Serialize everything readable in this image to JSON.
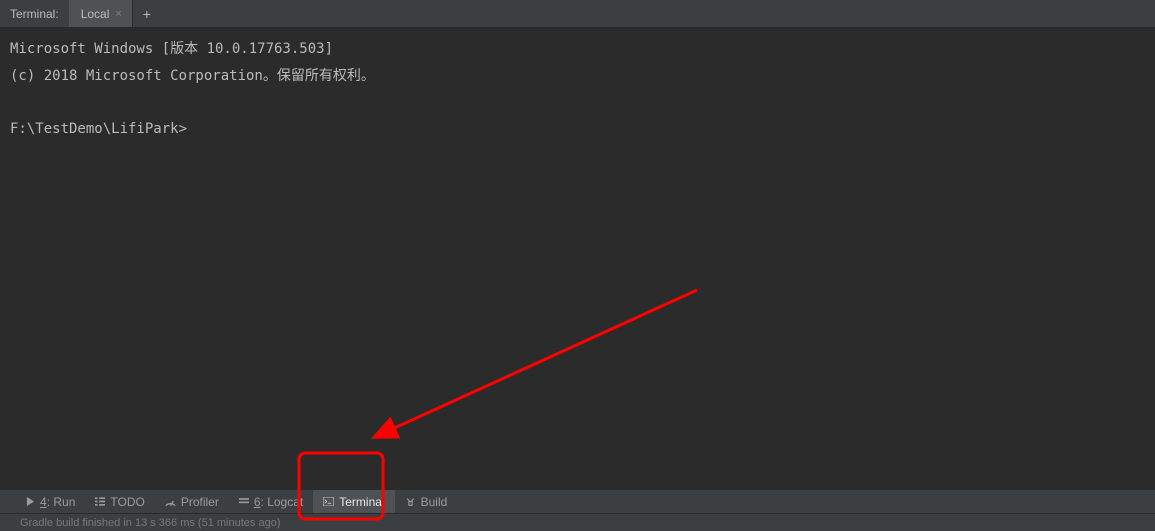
{
  "top": {
    "panel_label": "Terminal:",
    "tab_name": "Local"
  },
  "terminal": {
    "line1": "Microsoft Windows [版本 10.0.17763.503]",
    "line2": "(c) 2018 Microsoft Corporation。保留所有权利。",
    "blank": "",
    "prompt": "F:\\TestDemo\\LifiPark>"
  },
  "bottom": {
    "items": [
      {
        "prefix": "4",
        "label": ": Run"
      },
      {
        "prefix": "",
        "label": "TODO"
      },
      {
        "prefix": "",
        "label": "Profiler"
      },
      {
        "prefix": "6",
        "label": ": Logcat"
      },
      {
        "prefix": "",
        "label": "Terminal"
      },
      {
        "prefix": "",
        "label": "Build"
      }
    ]
  },
  "status": {
    "text": "Gradle build finished in 13 s 366 ms (51 minutes ago)"
  }
}
